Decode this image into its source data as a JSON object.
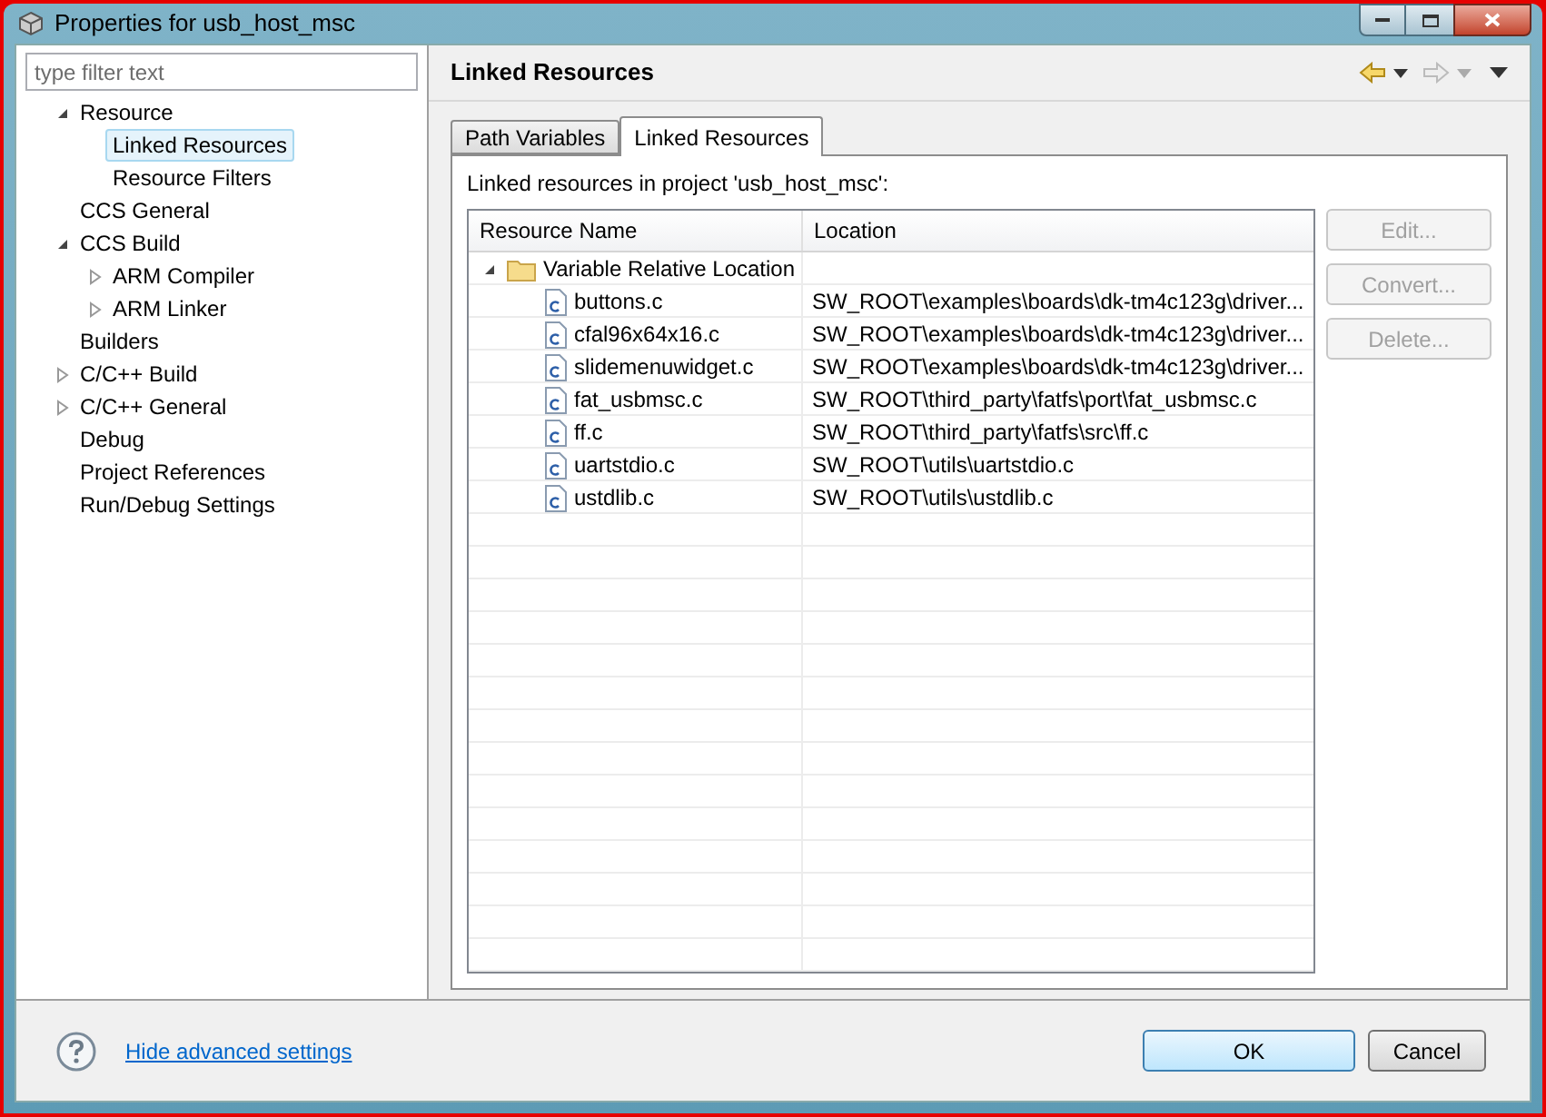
{
  "window": {
    "title": "Properties for usb_host_msc"
  },
  "filter": {
    "placeholder": "type filter text"
  },
  "tree": [
    {
      "label": "Resource",
      "expanded": true,
      "selected": false,
      "children": [
        {
          "label": "Linked Resources",
          "selected": true
        },
        {
          "label": "Resource Filters",
          "selected": false
        }
      ]
    },
    {
      "label": "CCS General",
      "selected": false
    },
    {
      "label": "CCS Build",
      "expanded": true,
      "selected": false,
      "children": [
        {
          "label": "ARM Compiler",
          "expanded": false,
          "selected": false
        },
        {
          "label": "ARM Linker",
          "expanded": false,
          "selected": false
        }
      ]
    },
    {
      "label": "Builders",
      "selected": false
    },
    {
      "label": "C/C++ Build",
      "expanded": false,
      "selected": false
    },
    {
      "label": "C/C++ General",
      "expanded": false,
      "selected": false
    },
    {
      "label": "Debug",
      "selected": false
    },
    {
      "label": "Project References",
      "selected": false
    },
    {
      "label": "Run/Debug Settings",
      "selected": false
    }
  ],
  "page": {
    "title": "Linked Resources"
  },
  "tabs": [
    {
      "label": "Path Variables",
      "selected": false
    },
    {
      "label": "Linked Resources",
      "selected": true
    }
  ],
  "description": "Linked resources in project 'usb_host_msc':",
  "table": {
    "columns": [
      "Resource Name",
      "Location"
    ],
    "rows": [
      {
        "name": "Variable Relative Location",
        "location": "",
        "expanded": true,
        "children": [
          {
            "name": "buttons.c",
            "location": "SW_ROOT\\examples\\boards\\dk-tm4c123g\\driver..."
          },
          {
            "name": "cfal96x64x16.c",
            "location": "SW_ROOT\\examples\\boards\\dk-tm4c123g\\driver..."
          },
          {
            "name": "slidemenuwidget.c",
            "location": "SW_ROOT\\examples\\boards\\dk-tm4c123g\\driver..."
          },
          {
            "name": "fat_usbmsc.c",
            "location": "SW_ROOT\\third_party\\fatfs\\port\\fat_usbmsc.c"
          },
          {
            "name": "ff.c",
            "location": "SW_ROOT\\third_party\\fatfs\\src\\ff.c"
          },
          {
            "name": "uartstdio.c",
            "location": "SW_ROOT\\utils\\uartstdio.c"
          },
          {
            "name": "ustdlib.c",
            "location": "SW_ROOT\\utils\\ustdlib.c"
          }
        ]
      }
    ]
  },
  "side_buttons": [
    {
      "label": "Edit...",
      "disabled": true
    },
    {
      "label": "Convert...",
      "disabled": true
    },
    {
      "label": "Delete...",
      "disabled": true
    }
  ],
  "footer": {
    "link": "Hide advanced settings",
    "buttons": [
      {
        "label": "OK",
        "default": true
      },
      {
        "label": "Cancel",
        "default": false
      }
    ]
  }
}
